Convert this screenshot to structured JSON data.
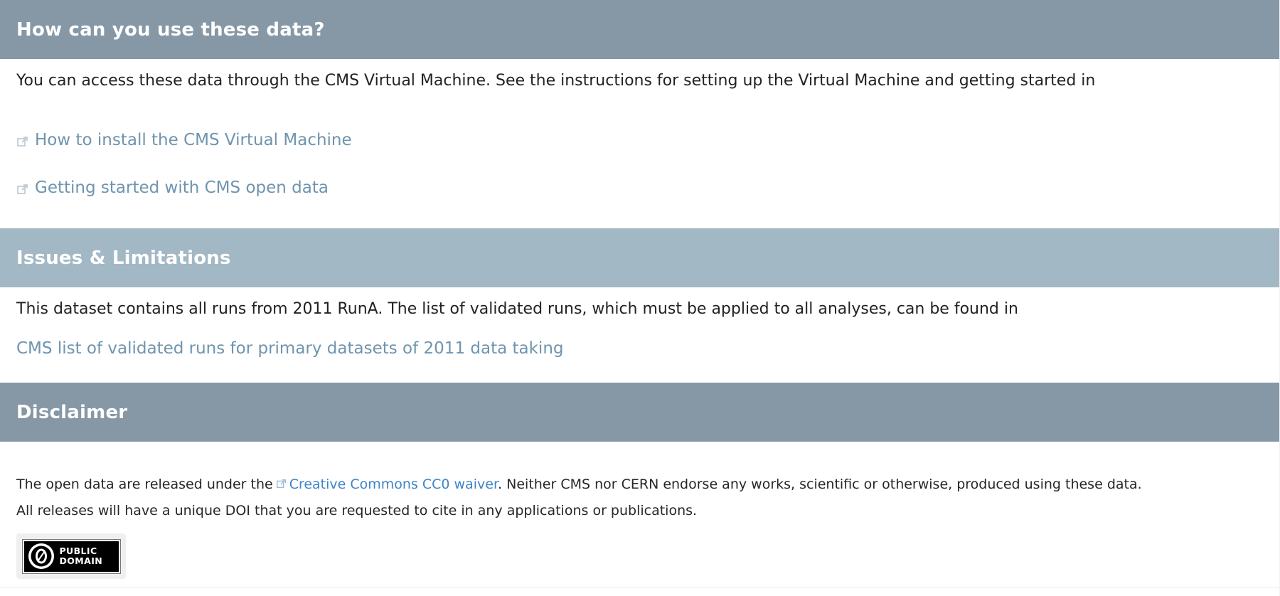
{
  "use_section": {
    "title": "How can you use these data?",
    "intro": "You can access these data through the CMS Virtual Machine. See the instructions for setting up the Virtual Machine and getting started in",
    "links": [
      {
        "label": "How to install the CMS Virtual Machine",
        "icon": "external-link-icon"
      },
      {
        "label": "Getting started with CMS open data",
        "icon": "external-link-icon"
      }
    ]
  },
  "issues_section": {
    "title": "Issues & Limitations",
    "intro": "This dataset contains all runs from 2011 RunA. The list of validated runs, which must be applied to all analyses, can be found in",
    "link": "CMS list of validated runs for primary datasets of 2011 data taking"
  },
  "disclaimer_section": {
    "title": "Disclaimer",
    "line1_prefix": "The open data are released under the",
    "line1_link": "Creative Commons CC0 waiver",
    "line1_suffix": ". Neither CMS nor CERN endorse any works, scientific or otherwise, produced using these data.",
    "line2": "All releases will have a unique DOI that you are requested to cite in any applications or publications.",
    "badge": {
      "line1": "PUBLIC",
      "line2": "DOMAIN",
      "icon": "cc0-zero-icon"
    }
  },
  "colors": {
    "header_dark": "#8698a5",
    "header_light": "#a2b8c5",
    "link": "#6f94ae",
    "inline_link": "#3f84c7"
  }
}
